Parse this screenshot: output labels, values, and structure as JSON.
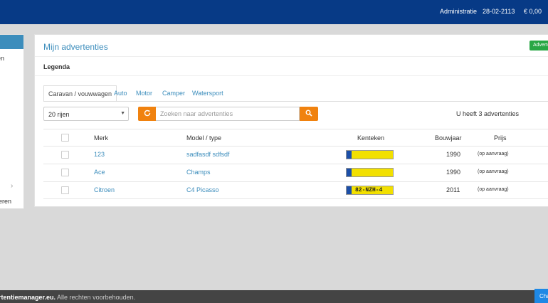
{
  "topbar": {
    "admin_label": "Administratie",
    "date": "28-02-2113",
    "balance": "€ 0,00",
    "bg_color": "#073a86"
  },
  "sidebar": {
    "item_text_1": "en",
    "item_text_2": "lieren",
    "chevron_icon": "chevron-right-icon"
  },
  "panel": {
    "title": "Mijn advertenties",
    "green_button": "Advertentie",
    "legenda": "Legenda"
  },
  "tabs": [
    {
      "label": "Caravan / vouwwagen",
      "active": true
    },
    {
      "label": "Auto",
      "active": false
    },
    {
      "label": "Motor",
      "active": false
    },
    {
      "label": "Camper",
      "active": false
    },
    {
      "label": "Watersport",
      "active": false
    }
  ],
  "toolbar": {
    "rows_select": "20 rijen",
    "refresh_icon": "refresh-icon",
    "search_placeholder": "Zoeken naar advertenties",
    "search_icon": "search-icon",
    "count_text": "U heeft 3 advertenties"
  },
  "table": {
    "headers": {
      "merk": "Merk",
      "model": "Model / type",
      "kenteken": "Kenteken",
      "bouwjaar": "Bouwjaar",
      "prijs": "Prijs"
    },
    "rows": [
      {
        "merk": "123",
        "model": "sadfasdf sdfsdf",
        "kenteken": "",
        "bouwjaar": "1990",
        "prijs": "(op aanvraag)"
      },
      {
        "merk": "Ace",
        "model": "Champs",
        "kenteken": "",
        "bouwjaar": "1990",
        "prijs": "(op aanvraag)"
      },
      {
        "merk": "Citroen",
        "model": "C4 Picasso",
        "kenteken": "82-NZH-4",
        "bouwjaar": "2011",
        "prijs": "(op aanvraag)"
      }
    ]
  },
  "footer": {
    "site": "rtentiemanager.eu.",
    "rights": " Alle rechten voorbehouden."
  },
  "chat_button": "Chat",
  "colors": {
    "accent": "#3c8dbc",
    "orange": "#f0820f",
    "green": "#28a745",
    "plate_yellow": "#f2e000"
  }
}
